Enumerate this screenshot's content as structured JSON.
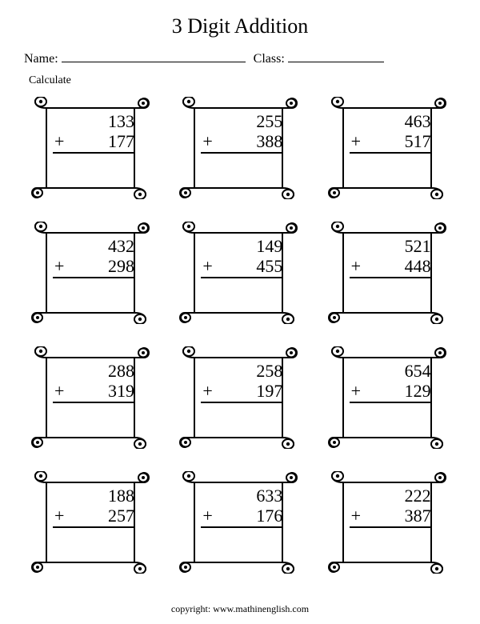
{
  "title": "3 Digit Addition",
  "labels": {
    "name": "Name:",
    "class": "Class:",
    "instruction": "Calculate",
    "operator": "+",
    "copyright": "copyright:   www.mathinenglish.com"
  },
  "problems": [
    {
      "a": "133",
      "b": "177"
    },
    {
      "a": "255",
      "b": "388"
    },
    {
      "a": "463",
      "b": "517"
    },
    {
      "a": "432",
      "b": "298"
    },
    {
      "a": "149",
      "b": "455"
    },
    {
      "a": "521",
      "b": "448"
    },
    {
      "a": "288",
      "b": "319"
    },
    {
      "a": "258",
      "b": "197"
    },
    {
      "a": "654",
      "b": "129"
    },
    {
      "a": "188",
      "b": "257"
    },
    {
      "a": "633",
      "b": "176"
    },
    {
      "a": "222",
      "b": "387"
    }
  ]
}
